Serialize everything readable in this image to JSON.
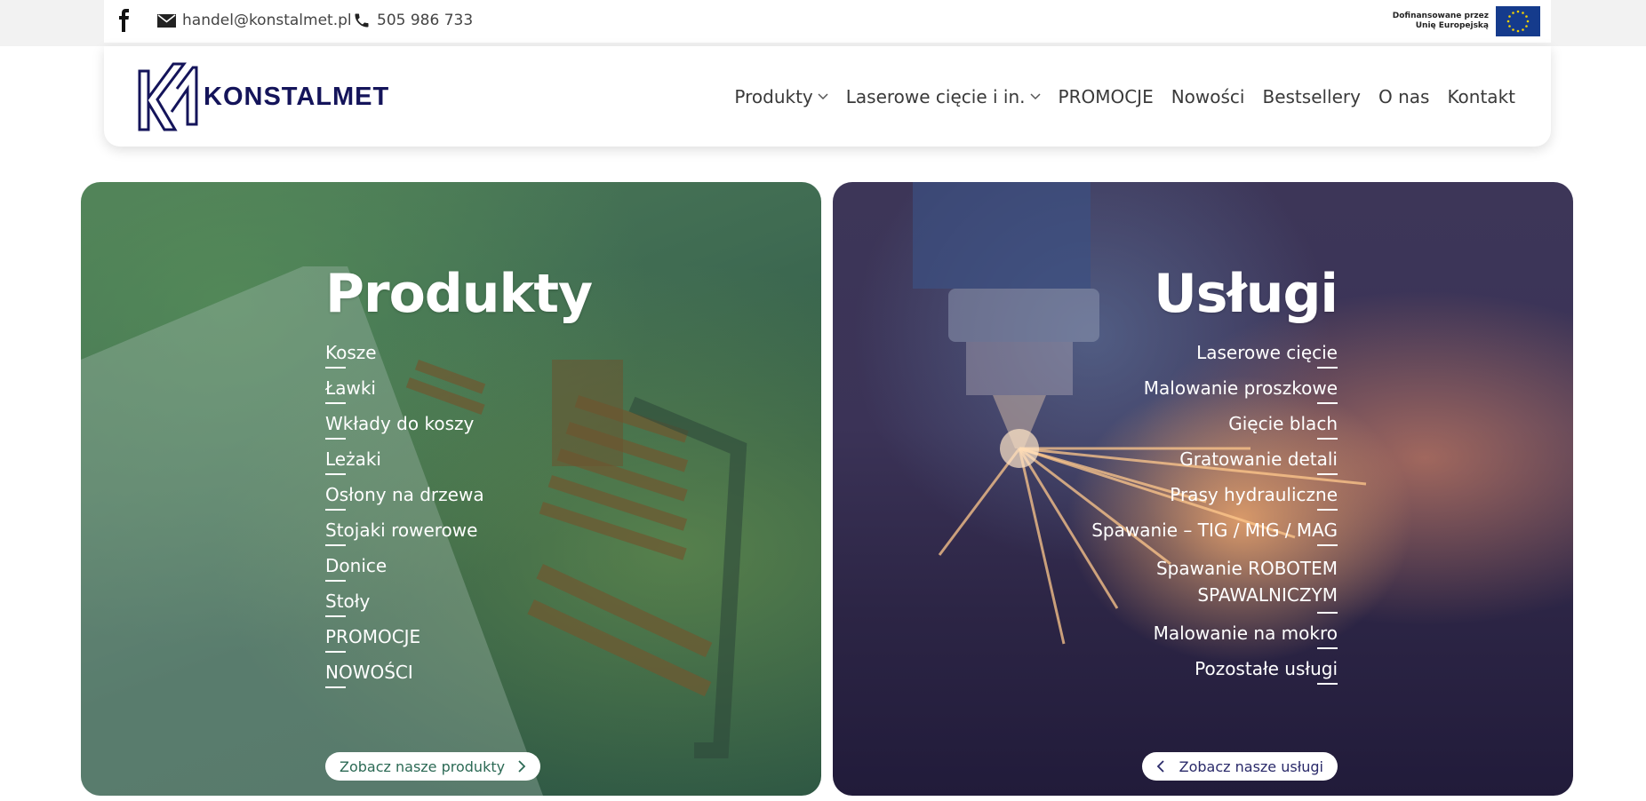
{
  "topbar": {
    "facebook_icon": "facebook-icon",
    "email": "handel@konstalmet.pl",
    "phone": "505 986 733",
    "eu_line1": "Dofinansowane przez",
    "eu_line2": "Unię Europejską"
  },
  "header": {
    "logo_text": "KONSTALMET",
    "nav": [
      {
        "label": "Produkty",
        "dropdown": true
      },
      {
        "label": "Laserowe cięcie i in.",
        "dropdown": true
      },
      {
        "label": "PROMOCJE",
        "dropdown": false
      },
      {
        "label": "Nowości",
        "dropdown": false
      },
      {
        "label": "Bestsellery",
        "dropdown": false
      },
      {
        "label": "O nas",
        "dropdown": false
      },
      {
        "label": "Kontakt",
        "dropdown": false
      }
    ]
  },
  "products": {
    "title": "Produkty",
    "links": [
      "Kosze",
      "Ławki",
      "Wkłady do koszy",
      "Leżaki",
      "Osłony na drzewa",
      "Stojaki rowerowe",
      "Donice",
      "Stoły",
      "PROMOCJE",
      "NOWOŚCI"
    ],
    "cta": "Zobacz nasze produkty"
  },
  "services": {
    "title": "Usługi",
    "links": [
      "Laserowe cięcie",
      "Malowanie proszkowe",
      "Gięcie blach",
      "Gratowanie detali",
      "Prasy hydrauliczne",
      "Spawanie – TIG / MIG / MAG",
      "Spawanie ROBOTEM SPAWALNICZYM",
      "Malowanie na mokro",
      "Pozostałe usługi"
    ],
    "cta": "Zobacz nasze usługi"
  },
  "colors": {
    "brand": "#14145a",
    "products_overlay": "#3f6b52",
    "services_overlay": "#2c2545"
  }
}
